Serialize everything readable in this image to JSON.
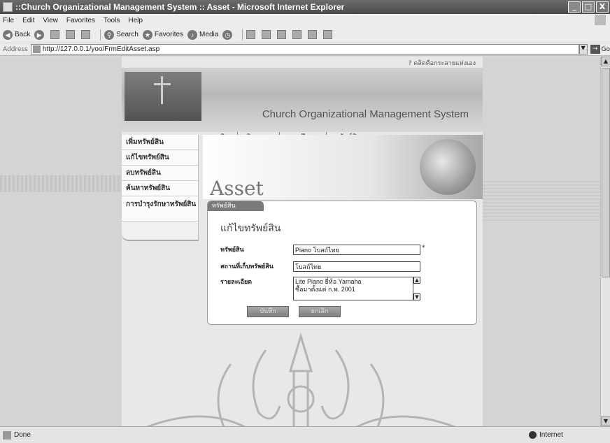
{
  "window": {
    "title": "::Church Organizational Management System :: Asset - Microsoft Internet Explorer",
    "controls": [
      "_",
      "□",
      "X"
    ]
  },
  "menubar": [
    "File",
    "Edit",
    "View",
    "Favorites",
    "Tools",
    "Help"
  ],
  "toolbar": {
    "back": "Back",
    "search": "Search",
    "favorites": "Favorites",
    "media": "Media"
  },
  "address": {
    "label": "Address",
    "url": "http://127.0.0.1/yoo/FrmEditAsset.asp",
    "go": "Go"
  },
  "site": {
    "top_link": "? คลิดคือกระลายแห่งเอง",
    "system_name": "Church Organizational Management System",
    "nav": [
      "สมาชิก",
      "กิจกรรม",
      "การศึกษา",
      "ทรัพย์สิน"
    ],
    "left_menu": [
      "เพิ่มทรัพย์สิน",
      "แก้ไขทรัพย์สิน",
      "ลบทรัพย์สิน",
      "ค้นหาทรัพย์สิน",
      "การบำรุงรักษาทรัพย์สิน"
    ],
    "banner_word": "Asset"
  },
  "form": {
    "tab": "ทรัพย์สิน",
    "title": "แก้ไขทรัพย์สิน",
    "fields": [
      {
        "label": "ทรัพย์สิน",
        "value": "Piano โบสถ์ไทย",
        "required": "*"
      },
      {
        "label": "สถานที่เก็บทรัพย์สิน",
        "value": "โบสถ์ไทย"
      },
      {
        "label": "รายละเอียด",
        "lines": [
          "Lite Piano ยี่ห้อ Yamaha",
          "ซื้อมาตั้งแต่ ก.พ. 2001"
        ]
      }
    ],
    "buttons": [
      "บันทึก",
      "ยกเลิก"
    ]
  },
  "status": {
    "left": "Done",
    "zone": "Internet"
  }
}
